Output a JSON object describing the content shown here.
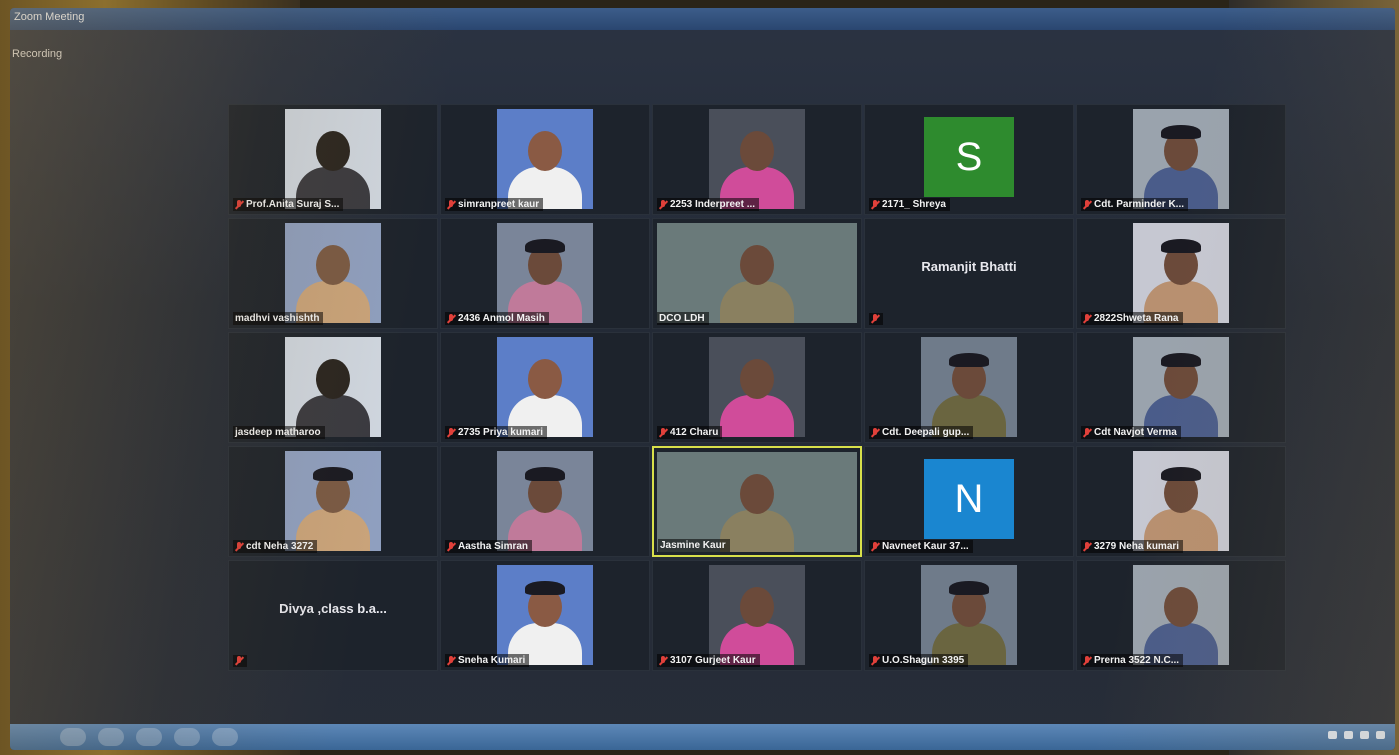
{
  "window": {
    "title": "Zoom Meeting",
    "recording_label": "Recording"
  },
  "colors": {
    "avatar_s": "#2e8b2e",
    "avatar_n": "#1a86d0",
    "mute_red": "#e0403a",
    "active_border": "#d8e04a"
  },
  "participants": [
    {
      "name": "Prof.Anita Suraj S...",
      "muted": true,
      "type": "video"
    },
    {
      "name": "simranpreet kaur",
      "muted": true,
      "type": "video"
    },
    {
      "name": "2253 Inderpreet ...",
      "muted": true,
      "type": "video"
    },
    {
      "name": "2171_ Shreya",
      "muted": true,
      "type": "avatar",
      "initial": "S",
      "avatar_color": "#2e8b2e"
    },
    {
      "name": "Cdt. Parminder K...",
      "muted": true,
      "type": "video"
    },
    {
      "name": "madhvi vashishth",
      "muted": false,
      "type": "video"
    },
    {
      "name": "2436 Anmol Masih",
      "muted": true,
      "type": "video"
    },
    {
      "name": "DCO LDH",
      "muted": false,
      "type": "video"
    },
    {
      "name": "Ramanjit Bhatti",
      "muted": true,
      "type": "name-only"
    },
    {
      "name": "2822Shweta Rana",
      "muted": true,
      "type": "video"
    },
    {
      "name": "jasdeep matharoo",
      "muted": false,
      "type": "video"
    },
    {
      "name": "2735 Priya kumari",
      "muted": true,
      "type": "video"
    },
    {
      "name": "412 Charu",
      "muted": true,
      "type": "video"
    },
    {
      "name": "Cdt. Deepali gup...",
      "muted": true,
      "type": "video"
    },
    {
      "name": "Cdt Navjot Verma",
      "muted": true,
      "type": "video"
    },
    {
      "name": "cdt Neha 3272",
      "muted": true,
      "type": "video"
    },
    {
      "name": "Aastha Simran",
      "muted": true,
      "type": "video"
    },
    {
      "name": "Jasmine Kaur",
      "muted": false,
      "type": "video",
      "active": true
    },
    {
      "name": "Navneet Kaur 37...",
      "muted": true,
      "type": "avatar",
      "initial": "N",
      "avatar_color": "#1a86d0"
    },
    {
      "name": "3279 Neha kumari",
      "muted": true,
      "type": "video"
    },
    {
      "name": "Divya ,class b.a...",
      "muted": true,
      "type": "name-only"
    },
    {
      "name": "Sneha Kumari",
      "muted": true,
      "type": "video"
    },
    {
      "name": "3107 Gurjeet Kaur",
      "muted": true,
      "type": "video"
    },
    {
      "name": "U.O.Shagun 3395",
      "muted": true,
      "type": "video"
    },
    {
      "name": "Prerna 3522 N.C...",
      "muted": true,
      "type": "video"
    }
  ]
}
